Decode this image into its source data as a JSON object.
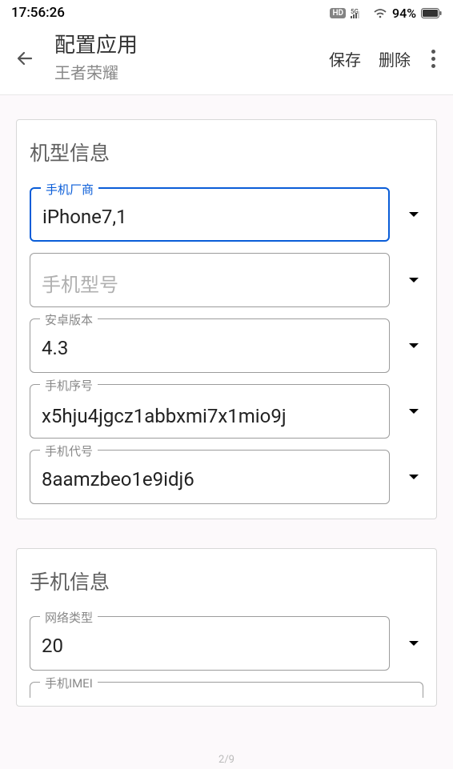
{
  "statusBar": {
    "time": "17:56:26",
    "network": "5G",
    "battery": "94%"
  },
  "header": {
    "title": "配置应用",
    "subtitle": "王者荣耀",
    "save": "保存",
    "delete": "删除"
  },
  "section1": {
    "title": "机型信息",
    "fields": {
      "vendor": {
        "label": "手机厂商",
        "value": "iPhone7,1"
      },
      "model": {
        "label": "手机型号",
        "value": ""
      },
      "androidVersion": {
        "label": "安卓版本",
        "value": "4.3"
      },
      "serial": {
        "label": "手机序号",
        "value": "x5hju4jgcz1abbxmi7x1mio9j"
      },
      "codename": {
        "label": "手机代号",
        "value": "8aamzbeo1e9idj6"
      }
    }
  },
  "section2": {
    "title": "手机信息",
    "fields": {
      "networkType": {
        "label": "网络类型",
        "value": "20"
      },
      "imei": {
        "label": "手机IMEI",
        "value": ""
      }
    }
  },
  "pageIndicator": "2/9"
}
